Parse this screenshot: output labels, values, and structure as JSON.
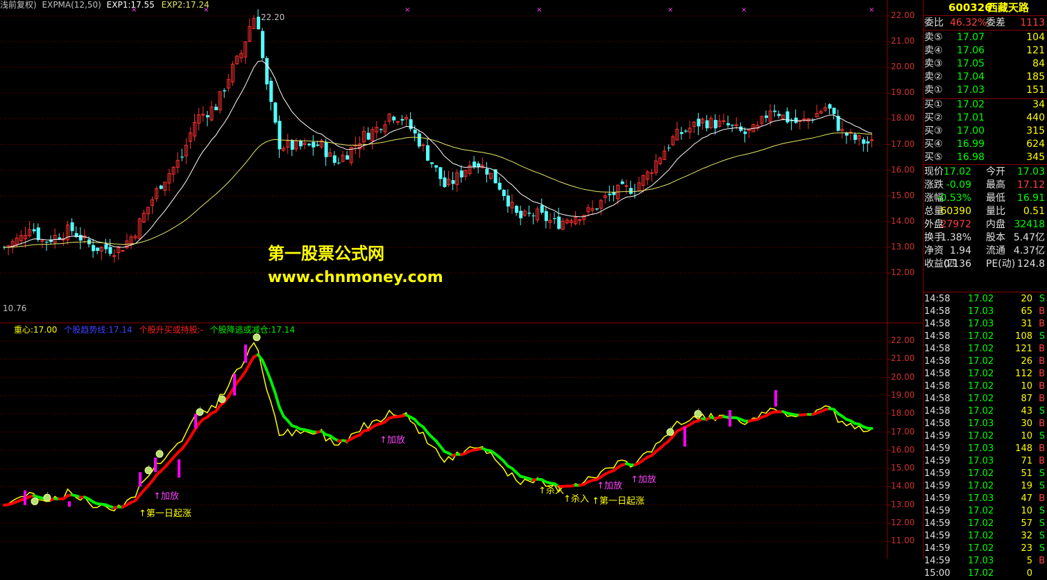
{
  "header": {
    "prefix": "浅前复权)",
    "expma": "EXPMA(12,50)",
    "exp1": "EXP1:17.55",
    "exp2": "EXP2:17.24"
  },
  "main_chart": {
    "high_label": "22.20",
    "low_label": "10.76",
    "y_ticks": [
      "22.00",
      "21.00",
      "20.00",
      "19.00",
      "18.00",
      "17.00",
      "16.00",
      "15.00",
      "14.00",
      "13.00",
      "12.00"
    ]
  },
  "sub_header": {
    "zhongxin": "重心:17.00",
    "l1": "个股趋势线:17.14",
    "l2": "个股升买或持股:-",
    "l3": "个股降逃或减仓:17.14"
  },
  "sub_chart": {
    "y_ticks": [
      "22.00",
      "21.00",
      "20.00",
      "19.00",
      "18.00",
      "17.00",
      "16.00",
      "15.00",
      "14.00",
      "13.00",
      "12.00",
      "11.00"
    ],
    "annotations": [
      {
        "text": "↑第一日起涨",
        "color": "#ffff00"
      },
      {
        "text": "↑加放",
        "color": "#ff44ff"
      },
      {
        "text": "↑加放",
        "color": "#ff44ff"
      },
      {
        "text": "↑杀入",
        "color": "#ffff00"
      },
      {
        "text": "↑杀入",
        "color": "#ffff00"
      },
      {
        "text": "↑加放",
        "color": "#ff44ff"
      },
      {
        "text": "↑第一日起涨",
        "color": "#ffff00"
      },
      {
        "text": "↑加放",
        "color": "#ff44ff"
      }
    ]
  },
  "watermark": {
    "line1": "第一股票公式网",
    "line2": "www.chnmoney.com"
  },
  "quote": {
    "code": "600326",
    "name": "西藏天路",
    "weibi_label": "委比",
    "weibi_value": "46.32%",
    "weicha_label": "委差",
    "weicha_value": "1113",
    "sell": [
      {
        "label": "卖⑤",
        "price": "17.07",
        "vol": "104"
      },
      {
        "label": "卖④",
        "price": "17.06",
        "vol": "121"
      },
      {
        "label": "卖③",
        "price": "17.05",
        "vol": "84"
      },
      {
        "label": "卖②",
        "price": "17.04",
        "vol": "185"
      },
      {
        "label": "卖①",
        "price": "17.03",
        "vol": "151"
      }
    ],
    "buy": [
      {
        "label": "买①",
        "price": "17.02",
        "vol": "34"
      },
      {
        "label": "买②",
        "price": "17.01",
        "vol": "440"
      },
      {
        "label": "买③",
        "price": "17.00",
        "vol": "315"
      },
      {
        "label": "买④",
        "price": "16.99",
        "vol": "624"
      },
      {
        "label": "买⑤",
        "price": "16.98",
        "vol": "345"
      }
    ],
    "stats": [
      {
        "l1": "现价",
        "v1": "17.02",
        "c1": "#00ff00",
        "l2": "今开",
        "v2": "17.03",
        "c2": "#00ff00"
      },
      {
        "l1": "涨跌",
        "v1": "-0.09",
        "c1": "#00ff00",
        "l2": "最高",
        "v2": "17.12",
        "c2": "#ff4040"
      },
      {
        "l1": "涨幅",
        "v1": "-0.53%",
        "c1": "#00ff00",
        "l2": "最低",
        "v2": "16.91",
        "c2": "#00ff00"
      },
      {
        "l1": "总量",
        "v1": "60390",
        "c1": "#ffff00",
        "l2": "量比",
        "v2": "0.51",
        "c2": "#ffff00"
      },
      {
        "l1": "外盘",
        "v1": "27972",
        "c1": "#ff4040",
        "l2": "内盘",
        "v2": "32418",
        "c2": "#00ff00"
      },
      {
        "l1": "换手",
        "v1": "1.38%",
        "c1": "#e0e0e0",
        "l2": "股本",
        "v2": "5.47亿",
        "c2": "#e0e0e0"
      },
      {
        "l1": "净资",
        "v1": "1.94",
        "c1": "#e0e0e0",
        "l2": "流通",
        "v2": "4.37亿",
        "c2": "#e0e0e0"
      },
      {
        "l1": "收益(四",
        "v1": "0.136",
        "c1": "#e0e0e0",
        "l2": "PE(动)",
        "v2": "124.8",
        "c2": "#e0e0e0"
      }
    ],
    "ticks": [
      {
        "t": "14:58",
        "p": "17.02",
        "v": "20",
        "s": "S"
      },
      {
        "t": "14:58",
        "p": "17.03",
        "v": "65",
        "s": "B"
      },
      {
        "t": "14:58",
        "p": "17.03",
        "v": "31",
        "s": "B"
      },
      {
        "t": "14:58",
        "p": "17.02",
        "v": "108",
        "s": "S"
      },
      {
        "t": "14:58",
        "p": "17.02",
        "v": "121",
        "s": "B"
      },
      {
        "t": "14:58",
        "p": "17.02",
        "v": "26",
        "s": "B"
      },
      {
        "t": "14:58",
        "p": "17.02",
        "v": "112",
        "s": "B"
      },
      {
        "t": "14:58",
        "p": "17.02",
        "v": "10",
        "s": "B"
      },
      {
        "t": "14:58",
        "p": "17.02",
        "v": "87",
        "s": "B"
      },
      {
        "t": "14:58",
        "p": "17.02",
        "v": "43",
        "s": "S"
      },
      {
        "t": "14:58",
        "p": "17.03",
        "v": "30",
        "s": "B"
      },
      {
        "t": "14:59",
        "p": "17.02",
        "v": "10",
        "s": "S"
      },
      {
        "t": "14:59",
        "p": "17.03",
        "v": "148",
        "s": "B"
      },
      {
        "t": "14:59",
        "p": "17.03",
        "v": "71",
        "s": "B"
      },
      {
        "t": "14:59",
        "p": "17.02",
        "v": "51",
        "s": "S"
      },
      {
        "t": "14:59",
        "p": "17.02",
        "v": "19",
        "s": "S"
      },
      {
        "t": "14:59",
        "p": "17.03",
        "v": "47",
        "s": "B"
      },
      {
        "t": "14:59",
        "p": "17.02",
        "v": "10",
        "s": "S"
      },
      {
        "t": "14:59",
        "p": "17.02",
        "v": "57",
        "s": "S"
      },
      {
        "t": "14:59",
        "p": "17.02",
        "v": "32",
        "s": "S"
      },
      {
        "t": "14:59",
        "p": "17.02",
        "v": "23",
        "s": "S"
      },
      {
        "t": "14:59",
        "p": "17.03",
        "v": "5",
        "s": "B"
      },
      {
        "t": "15:00",
        "p": "17.02",
        "v": "0",
        "s": ""
      }
    ]
  },
  "colors": {
    "up": "#ff3030",
    "down": "#54ffff",
    "grid": "#8b0000",
    "exp1": "#ffffff",
    "exp2": "#e8e86a",
    "trend_up": "#ff0000",
    "trend_down": "#00ee00",
    "price_line": "#ffff00",
    "signal_bar": "#ff00ff"
  }
}
